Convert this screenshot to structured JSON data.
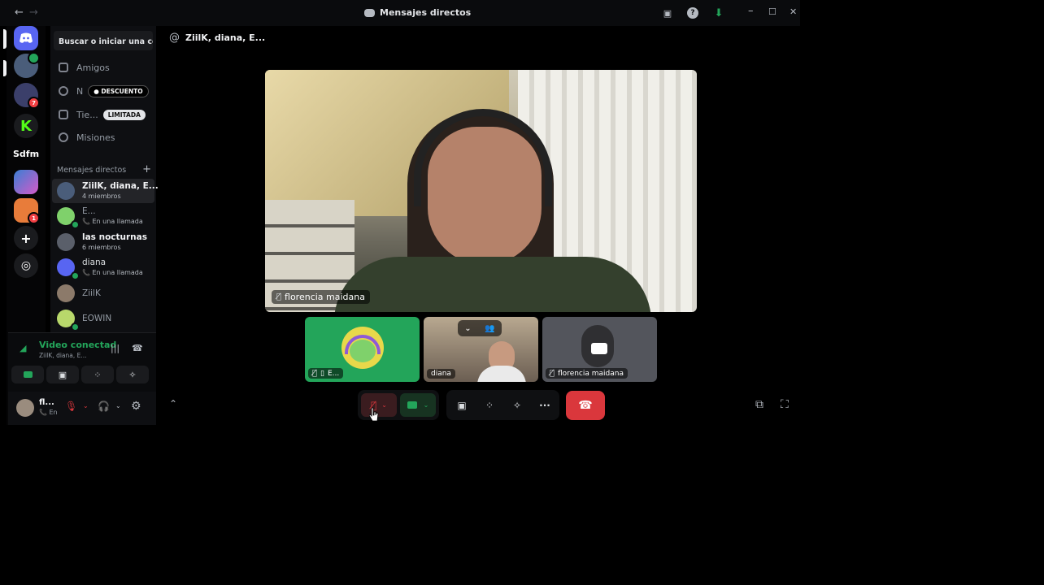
{
  "window": {
    "title": "Mensajes directos",
    "back": "←",
    "forward": "→",
    "controls": {
      "minimize": "–",
      "maximize": "☐",
      "close": "✕"
    }
  },
  "guilds": [
    {
      "label": "",
      "color": "#5865f2",
      "icon": "discord-logo-icon"
    },
    {
      "label": "",
      "color": "#4a5d7a",
      "icon": "group-avatar-icon"
    },
    {
      "label": "",
      "color": "#3b3f6a",
      "icon": "server-avatar-icon",
      "badge": "7"
    },
    {
      "label": "K",
      "color": "#1a1b1e",
      "icon": "kick-server-icon"
    },
    {
      "label": "Sdfm",
      "color": "transparent",
      "icon": "text-server-icon"
    },
    {
      "label": "",
      "color": "#3a7fd5",
      "icon": "colorful-server-icon"
    },
    {
      "label": "",
      "color": "#e87c3a",
      "icon": "server-avatar-icon",
      "badge": "1"
    },
    {
      "label": "+",
      "color": "#1a1b1e",
      "icon": "add-server-icon"
    },
    {
      "label": "◎",
      "color": "#1a1b1e",
      "icon": "discover-icon"
    }
  ],
  "sidebar": {
    "search": "Buscar o iniciar una co...",
    "nav": [
      {
        "label": "Amigos",
        "icon": "friends-icon"
      },
      {
        "label": "N",
        "icon": "nitro-icon",
        "pill": "● DESCUENTO"
      },
      {
        "label": "Tie...",
        "icon": "shop-icon",
        "pill": "LIMITADA"
      },
      {
        "label": "Misiones",
        "icon": "quests-icon"
      }
    ],
    "dm_header": "Mensajes directos",
    "dm_add": "+",
    "dms": [
      {
        "name": "ZiilK, diana, E...",
        "sub": "4 miembros",
        "selected": true,
        "avatar": "#4a5d7a"
      },
      {
        "name": "E...",
        "sub": "📞 En una llamada",
        "dim": true,
        "avatar": "#7fd16b"
      },
      {
        "name": "las nocturnas",
        "sub": "6 miembros",
        "avatar": "#5a5f6a"
      },
      {
        "name": "diana",
        "sub": "📞 En una llamada",
        "avatar": "#5865f2"
      },
      {
        "name": "ZiilK",
        "sub": "",
        "avatar": "#8c7a6a"
      },
      {
        "name": "EOWIN",
        "sub": "",
        "avatar": "#b8d86b"
      }
    ]
  },
  "voice": {
    "status": "Video conectad",
    "channel": "ZiilK, diana, E...",
    "icons": {
      "signal": "signal-icon",
      "noise": "noise-suppression-icon",
      "disconnect": "disconnect-icon"
    }
  },
  "user": {
    "name": "fl...",
    "status": "📞 En"
  },
  "header": {
    "at": "@",
    "title": "ZiilK, diana, E..."
  },
  "main_video": {
    "name": "florencia maidana"
  },
  "tiles": [
    {
      "name": "E...",
      "id": "tile-e"
    },
    {
      "name": "diana",
      "id": "tile-diana"
    },
    {
      "name": "florencia maidana",
      "id": "tile-florencia"
    }
  ],
  "controls": {
    "more": "···"
  }
}
